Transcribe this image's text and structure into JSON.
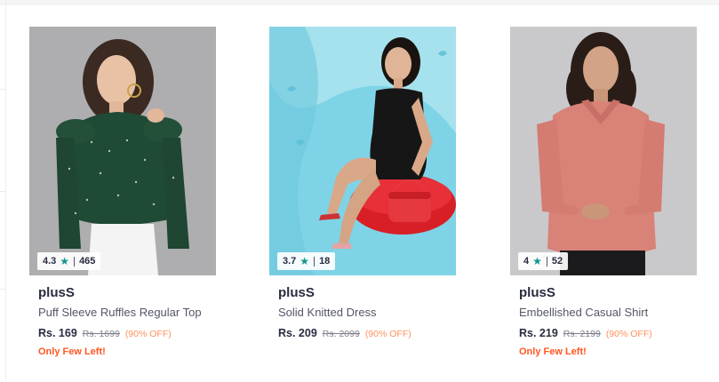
{
  "products": [
    {
      "rating": "4.3",
      "rating_count": "465",
      "brand": "plusS",
      "name": "Puff Sleeve Ruffles Regular Top",
      "price": "Rs. 169",
      "mrp": "Rs. 1699",
      "discount": "(90% OFF)",
      "stock_note": "Only Few Left!"
    },
    {
      "rating": "3.7",
      "rating_count": "18",
      "brand": "plusS",
      "name": "Solid Knitted Dress",
      "price": "Rs. 209",
      "mrp": "Rs. 2099",
      "discount": "(90% OFF)",
      "stock_note": ""
    },
    {
      "rating": "4",
      "rating_count": "52",
      "brand": "plusS",
      "name": "Embellished Casual Shirt",
      "price": "Rs. 219",
      "mrp": "Rs. 2199",
      "discount": "(90% OFF)",
      "stock_note": "Only Few Left!"
    }
  ],
  "colors": {
    "rating_star": "#14958f",
    "discount": "#ff905a",
    "stock_note": "#ff5722"
  },
  "icons": {
    "rating": "star-icon"
  }
}
